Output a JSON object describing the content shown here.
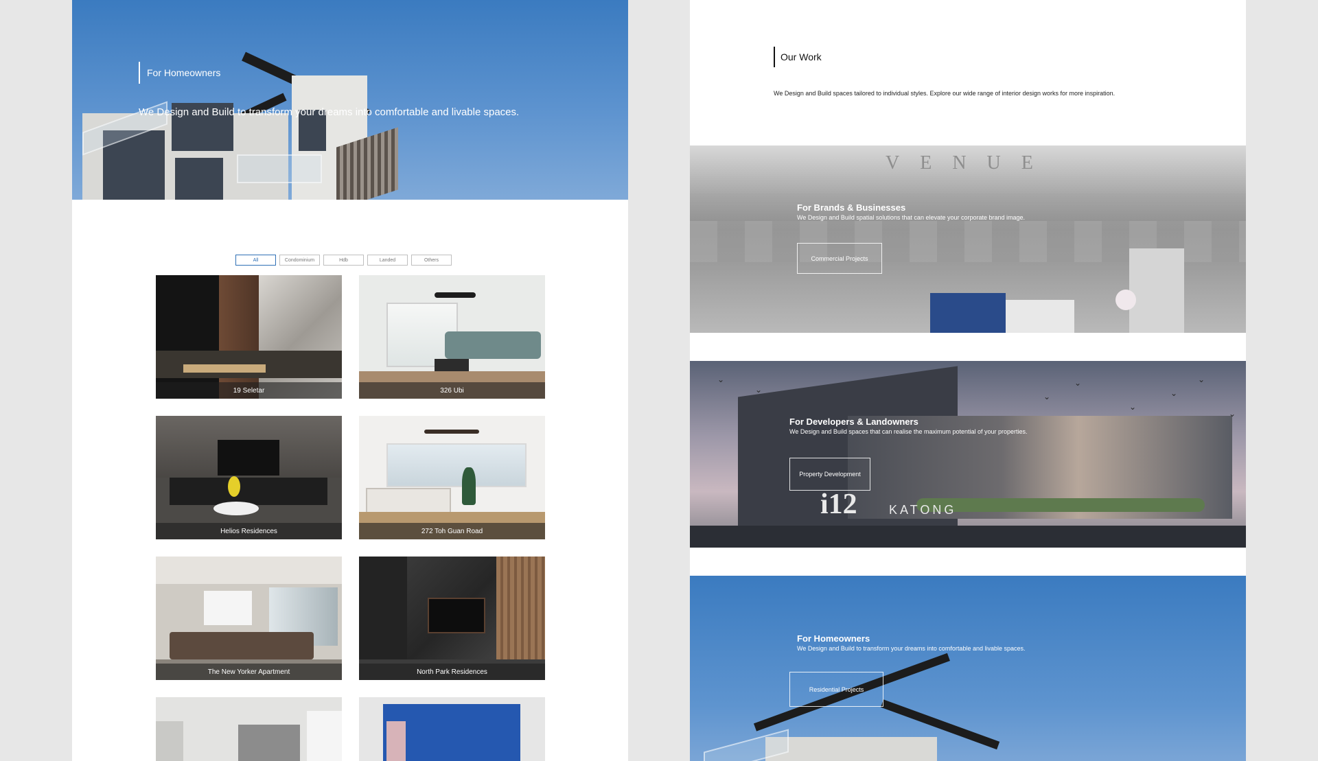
{
  "left": {
    "hero": {
      "tag": "For Homeowners",
      "description": "We Design and Build to transform your dreams into comfortable and livable spaces."
    },
    "filters": [
      "All",
      "Condominium",
      "Hdb",
      "Landed",
      "Others"
    ],
    "projects": [
      {
        "name": "19 Seletar"
      },
      {
        "name": "326 Ubi"
      },
      {
        "name": "Helios Residences"
      },
      {
        "name": "272 Toh Guan Road"
      },
      {
        "name": "The New Yorker Apartment"
      },
      {
        "name": "North Park Residences"
      }
    ]
  },
  "right": {
    "section_title": "Our Work",
    "section_description": "We Design and Build spaces tailored to individual styles. Explore our wide range of interior design works for more inspiration.",
    "banners": [
      {
        "sign": "VENUE",
        "title": "For Brands & Businesses",
        "description": "We Design and Build spatial solutions that can elevate your corporate brand image.",
        "button": "Commercial Projects"
      },
      {
        "sign": "KATONG",
        "sign_mark": "i12",
        "title": "For Developers & Landowners",
        "description": "We Design and Build spaces that can realise the maximum potential of your properties.",
        "button": "Property Development"
      },
      {
        "title": "For Homeowners",
        "description": "We Design and Build to transform your dreams into comfortable and livable spaces.",
        "button": "Residential Projects"
      }
    ]
  },
  "colors": {
    "background": "#e7e7e7",
    "sky": "#3b7bc0",
    "active_filter": "#2e6fb5"
  }
}
